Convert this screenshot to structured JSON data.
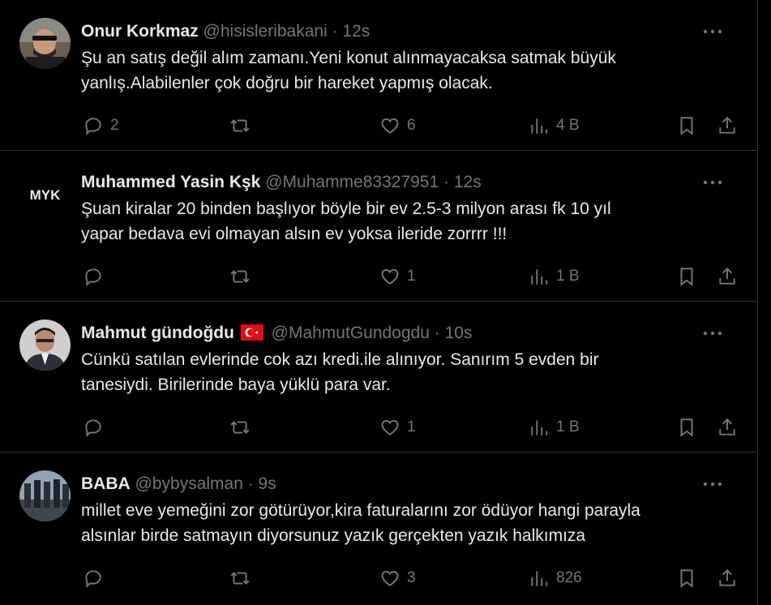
{
  "tweets": [
    {
      "name": "Onur Korkmaz",
      "handle": "@hisisleribakani",
      "time": "· 12s",
      "text": "Şu an satış değil alım zamanı.Yeni konut alınmayacaksa satmak büyük\nyanlış.Alabilenler çok doğru bir hareket yapmış olacak.",
      "replies": "2",
      "retweets": "",
      "likes": "6",
      "views": "4 B"
    },
    {
      "name": "Muhammed Yasin Kşk",
      "handle": "@Muhamme83327951",
      "time": "· 12s",
      "avatar_text": "MYK",
      "text": "Şuan kiralar 20 binden başlıyor böyle bir ev 2.5-3 milyon arası fk 10 yıl\nyapar bedava evi olmayan alsın ev yoksa ileride zorrrr !!!",
      "replies": "",
      "retweets": "",
      "likes": "1",
      "views": "1 B"
    },
    {
      "name": "Mahmut gündoğdu",
      "handle": "@MahmutGundogdu",
      "time": "· 10s",
      "text": "Cünkü satılan evlerinde cok azı kredi.ile alınıyor. Sanırım 5 evden bir\ntanesiydi.  Birilerinde baya yüklü para var.",
      "replies": "",
      "retweets": "",
      "likes": "1",
      "views": "1 B"
    },
    {
      "name": "BABA",
      "handle": "@bybysalman",
      "time": "· 9s",
      "text": "millet eve yemeğini zor götürüyor,kira faturalarını zor ödüyor hangi parayla\nalsınlar birde satmayın diyorsunuz yazık gerçekten yazık halkımıza",
      "replies": "",
      "retweets": "",
      "likes": "3",
      "views": "826"
    }
  ],
  "icons": {
    "more": "more-horizontal-icon",
    "reply": "reply-icon",
    "retweet": "retweet-icon",
    "like": "heart-icon",
    "views": "views-chart-icon",
    "bookmark": "bookmark-icon",
    "share": "share-icon",
    "flag": "turkey-flag-icon"
  },
  "colors": {
    "background": "#000000",
    "text": "#e7e9ea",
    "muted": "#71767b",
    "divider": "#2f3336",
    "flag_red": "#e30a17"
  }
}
